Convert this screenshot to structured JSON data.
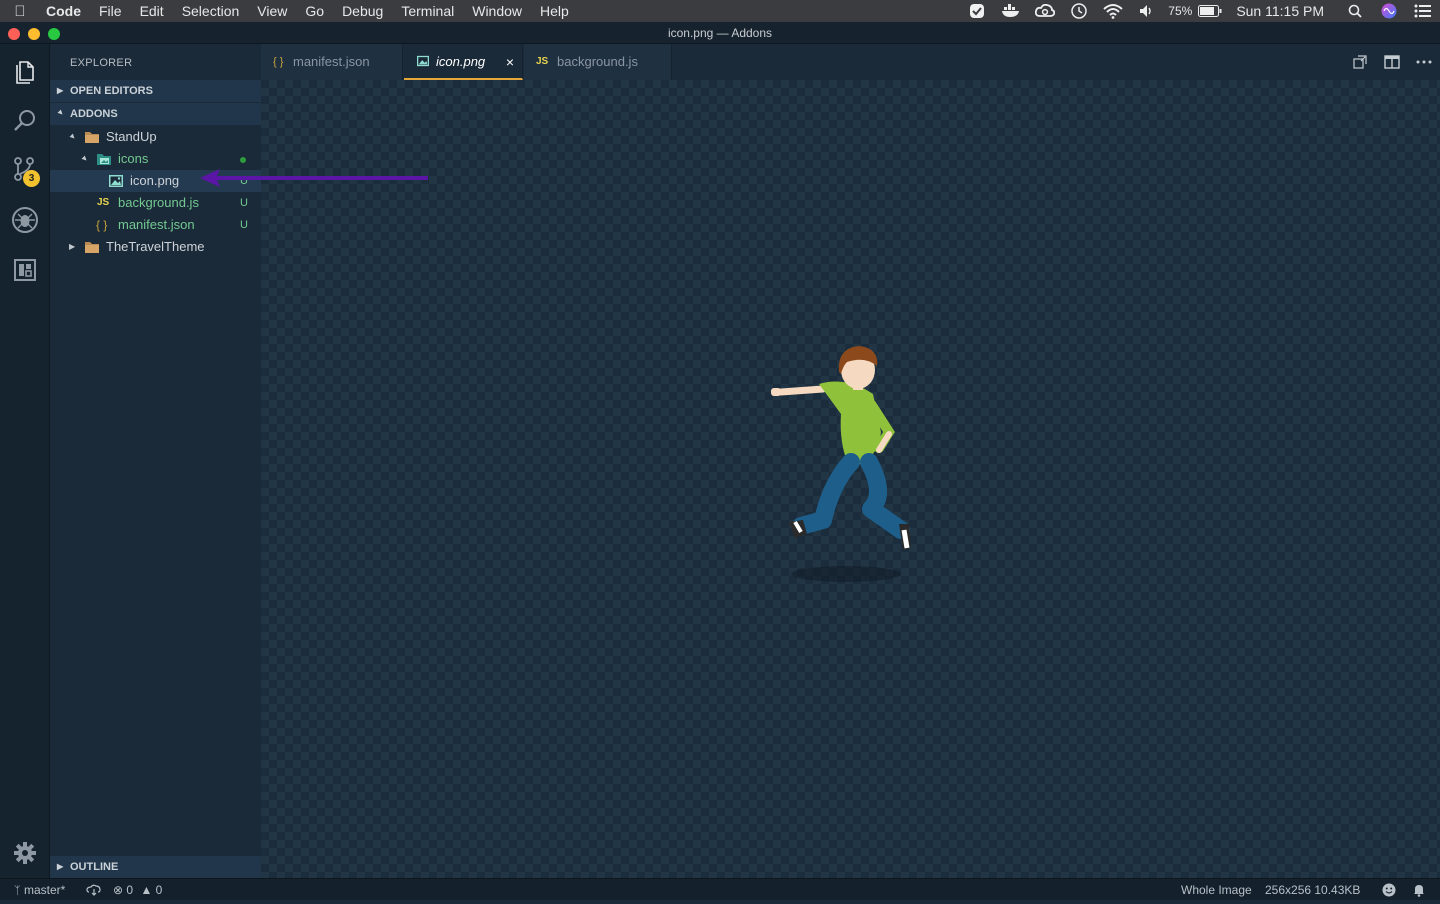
{
  "menubar": {
    "app": "Code",
    "items": [
      "File",
      "Edit",
      "Selection",
      "View",
      "Go",
      "Debug",
      "Terminal",
      "Window",
      "Help"
    ],
    "battery": "75%",
    "clock": "Sun 11:15 PM"
  },
  "window": {
    "title": "icon.png — Addons"
  },
  "activity": {
    "items": [
      "files-icon",
      "search-icon",
      "source-control-icon",
      "debug-icon",
      "extensions-icon",
      "gear-icon"
    ],
    "scm_badge": "3"
  },
  "sidebar": {
    "title": "EXPLORER",
    "open_editors": "OPEN EDITORS",
    "folder": "ADDONS",
    "tree": [
      {
        "label": "StandUp",
        "kind": "folder",
        "status": ""
      },
      {
        "label": "icons",
        "kind": "folder",
        "status": ""
      },
      {
        "label": "icon.png",
        "kind": "image",
        "status": "U"
      },
      {
        "label": "background.js",
        "kind": "js",
        "status": "U"
      },
      {
        "label": "manifest.json",
        "kind": "json",
        "status": "U"
      },
      {
        "label": "TheTravelTheme",
        "kind": "folder",
        "status": ""
      }
    ],
    "outline": "OUTLINE"
  },
  "tabs": [
    {
      "icon": "{ }",
      "label": "manifest.json"
    },
    {
      "icon": "img",
      "label": "icon.png"
    },
    {
      "icon": "JS",
      "label": "background.js"
    }
  ],
  "icons": {
    "json": "{ }",
    "js": "JS"
  },
  "statusbar": {
    "branch": "master*",
    "errors": "0",
    "warnings": "0",
    "zoom": "Whole Image",
    "image_info": "256x256 10.43KB"
  },
  "colors": {
    "accent_tab": "#e5a63a",
    "untracked": "#73c991",
    "js_yellow": "#e8d44d",
    "json_yellow": "#c7a33a",
    "arrow": "#5b16a8"
  }
}
